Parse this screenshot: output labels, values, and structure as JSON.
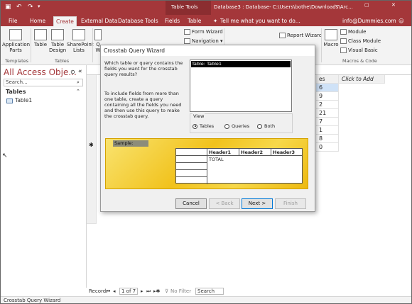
{
  "titlebar": {
    "table_tools": "Table Tools",
    "doc_title": "Database3 : Database- C:\\Users\\bothe\\Downloads\\Arc...",
    "account": "info@Dummies.com"
  },
  "tabs": [
    "File",
    "Home",
    "Create",
    "External Data",
    "Database Tools",
    "Fields",
    "Table"
  ],
  "active_tab": "Create",
  "tell_me": "Tell me what you want to do...",
  "ribbon": {
    "application_parts": "Application Parts",
    "table": "Table",
    "table_design": "Table Design",
    "sharepoint_lists": "SharePoint Lists",
    "query_partial": "Q W",
    "form_wizard": "Form Wizard",
    "navigation": "Navigation",
    "report_wizard": "Report Wizard",
    "macro": "Macro",
    "module": "Module",
    "class_module": "Class Module",
    "visual_basic": "Visual Basic",
    "groups": {
      "templates": "Templates",
      "tables": "Tables",
      "macros_code": "Macros & Code"
    }
  },
  "nav": {
    "title": "All Access Obje...",
    "search_placeholder": "Search...",
    "section": "Tables",
    "item": "Table1"
  },
  "datasheet": {
    "col_partial": "es",
    "click_to_add": "Click to Add",
    "values": [
      "6",
      "9",
      "2",
      "21",
      "7",
      "1",
      "8",
      "0"
    ],
    "new_row_marker": "✱"
  },
  "record_bar": {
    "label": "Record:",
    "position": "1 of 7",
    "filter": "No Filter",
    "search": "Search"
  },
  "status": "Crosstab Query Wizard",
  "dialog": {
    "title": "Crosstab Query Wizard",
    "text1": "Which table or query contains the fields you want for the crosstab query results?",
    "text2": "To include fields from more than one table, create a query containing all the fields you need and then use this query to make the crosstab query.",
    "list_selected": "Table: Table1",
    "view_label": "View",
    "radios": [
      "Tables",
      "Queries",
      "Both"
    ],
    "selected_radio": "Tables",
    "sample_label": "Sample:",
    "headers": [
      "Header1",
      "Header2",
      "Header3"
    ],
    "total": "TOTAL",
    "buttons": {
      "cancel": "Cancel",
      "back": "< Back",
      "next": "Next >",
      "finish": "Finish"
    }
  }
}
